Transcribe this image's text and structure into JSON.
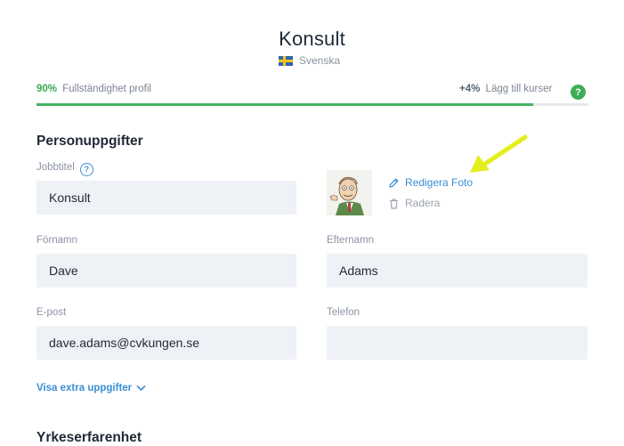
{
  "header": {
    "title": "Konsult",
    "language": "Svenska",
    "flag_icon": "sweden-flag-icon"
  },
  "progress": {
    "percent_label": "90%",
    "label": "Fullständighet profil",
    "value": 0.9,
    "hint_percent": "+4%",
    "hint_label": "Lägg till kurser",
    "help_label": "?"
  },
  "personal": {
    "section_title": "Personuppgifter",
    "job_title": {
      "label": "Jobbtitel",
      "value": "Konsult"
    },
    "photo": {
      "edit_label": "Redigera Foto",
      "delete_label": "Radera"
    },
    "first_name": {
      "label": "Förnamn",
      "value": "Dave"
    },
    "last_name": {
      "label": "Efternamn",
      "value": "Adams"
    },
    "email": {
      "label": "E-post",
      "value": "dave.adams@cvkungen.se"
    },
    "phone": {
      "label": "Telefon",
      "value": ""
    },
    "extra_link": "Visa extra uppgifter"
  },
  "experience": {
    "section_title": "Yrkeserfarenhet"
  },
  "colors": {
    "accent": "#3b8ed6",
    "progress": "#45b362",
    "annotation_arrow": "#e6f01f"
  }
}
